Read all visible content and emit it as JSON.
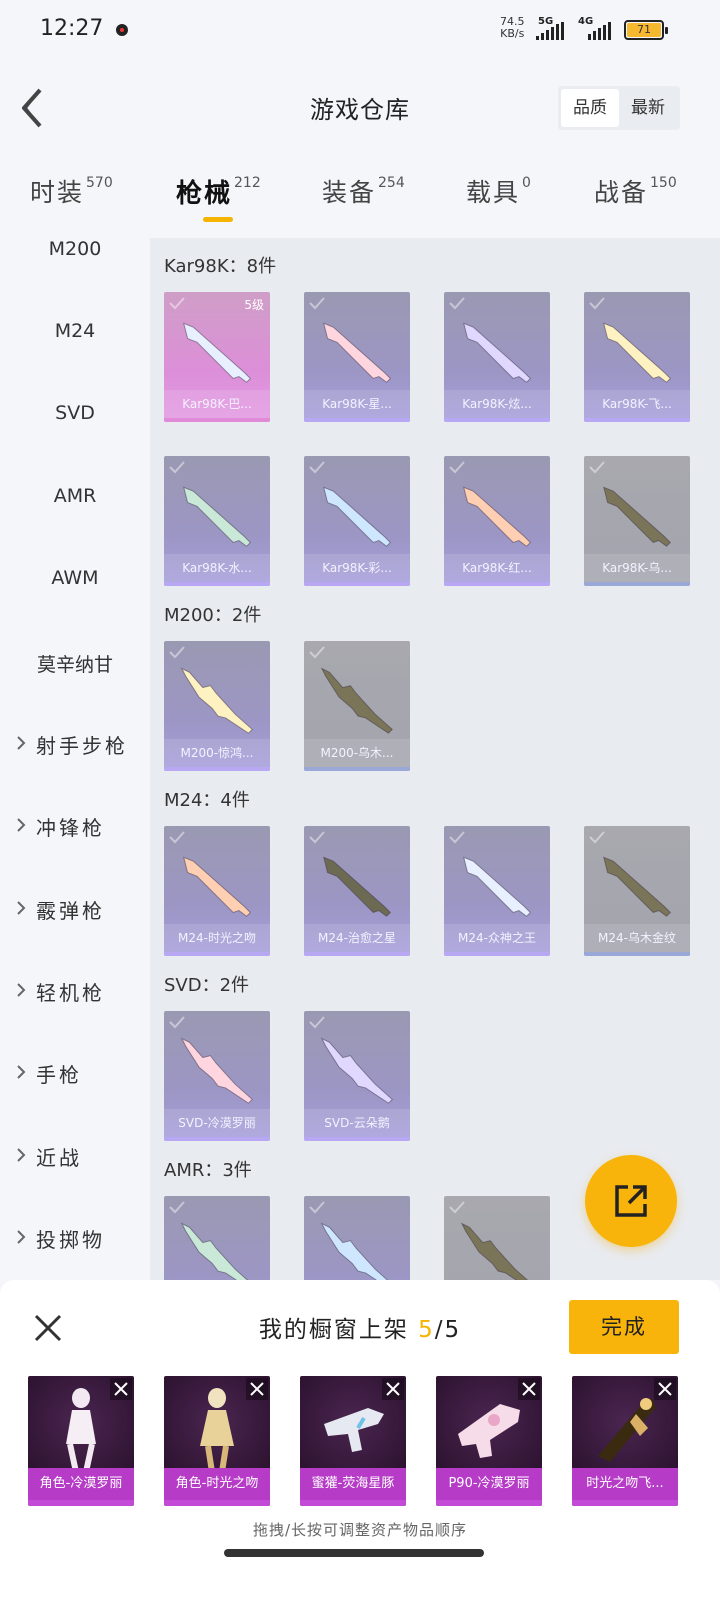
{
  "status_bar": {
    "time": "12:27",
    "speed_value": "74.5",
    "speed_unit": "KB/s",
    "net1": "5G",
    "net2": "4G",
    "battery": "71"
  },
  "header": {
    "title": "游戏仓库",
    "sort_quality": "品质",
    "sort_newest": "最新"
  },
  "tabs": [
    {
      "label": "时装",
      "count": "570"
    },
    {
      "label": "枪械",
      "count": "212"
    },
    {
      "label": "装备",
      "count": "254"
    },
    {
      "label": "载具",
      "count": "0"
    },
    {
      "label": "战备",
      "count": "150"
    }
  ],
  "sidebar": {
    "items": [
      "M200",
      "M24",
      "SVD",
      "AMR",
      "AWM",
      "莫辛纳甘"
    ],
    "groups": [
      "射手步枪",
      "冲锋枪",
      "霰弹枪",
      "轻机枪",
      "手枪",
      "近战",
      "投掷物"
    ]
  },
  "sections": [
    {
      "title": "Kar98K：8件",
      "items": [
        {
          "label": "Kar98K-巴...",
          "level": "5级",
          "style": "pink"
        },
        {
          "label": "Kar98K-星...",
          "style": "purple"
        },
        {
          "label": "Kar98K-炫...",
          "style": "purple"
        },
        {
          "label": "Kar98K-飞...",
          "style": "purple"
        },
        {
          "label": "Kar98K-水...",
          "style": "purple"
        },
        {
          "label": "Kar98K-彩...",
          "style": "purple"
        },
        {
          "label": "Kar98K-红...",
          "style": "purple"
        },
        {
          "label": "Kar98K-乌...",
          "style": "grey"
        }
      ]
    },
    {
      "title": "M200：2件",
      "items": [
        {
          "label": "M200-惊鸿...",
          "style": "purple"
        },
        {
          "label": "M200-乌木...",
          "style": "grey"
        }
      ]
    },
    {
      "title": "M24：4件",
      "items": [
        {
          "label": "M24-时光之吻",
          "style": "purple"
        },
        {
          "label": "M24-治愈之星",
          "style": "purple"
        },
        {
          "label": "M24-众神之王",
          "style": "purple"
        },
        {
          "label": "M24-乌木金纹",
          "style": "grey"
        }
      ]
    },
    {
      "title": "SVD：2件",
      "items": [
        {
          "label": "SVD-冷漠罗丽",
          "style": "purple"
        },
        {
          "label": "SVD-云朵鹅",
          "style": "purple"
        }
      ]
    },
    {
      "title": "AMR：3件",
      "items": [
        {
          "label": "",
          "style": "purple"
        },
        {
          "label": "",
          "style": "purple"
        },
        {
          "label": "",
          "style": "grey"
        }
      ]
    }
  ],
  "sheet": {
    "title_prefix": "我的橱窗上架 ",
    "current": "5",
    "total": "/5",
    "done_label": "完成",
    "hint": "拖拽/长按可调整资产物品顺序",
    "items": [
      {
        "label": "角色-冷漠罗丽"
      },
      {
        "label": "角色-时光之吻"
      },
      {
        "label": "蜜獾-荧海星豚"
      },
      {
        "label": "P90-冷漠罗丽"
      },
      {
        "label": "时光之吻飞..."
      }
    ]
  },
  "colors": {
    "accent": "#f8b40a",
    "shelf_label": "#b63bc7"
  }
}
